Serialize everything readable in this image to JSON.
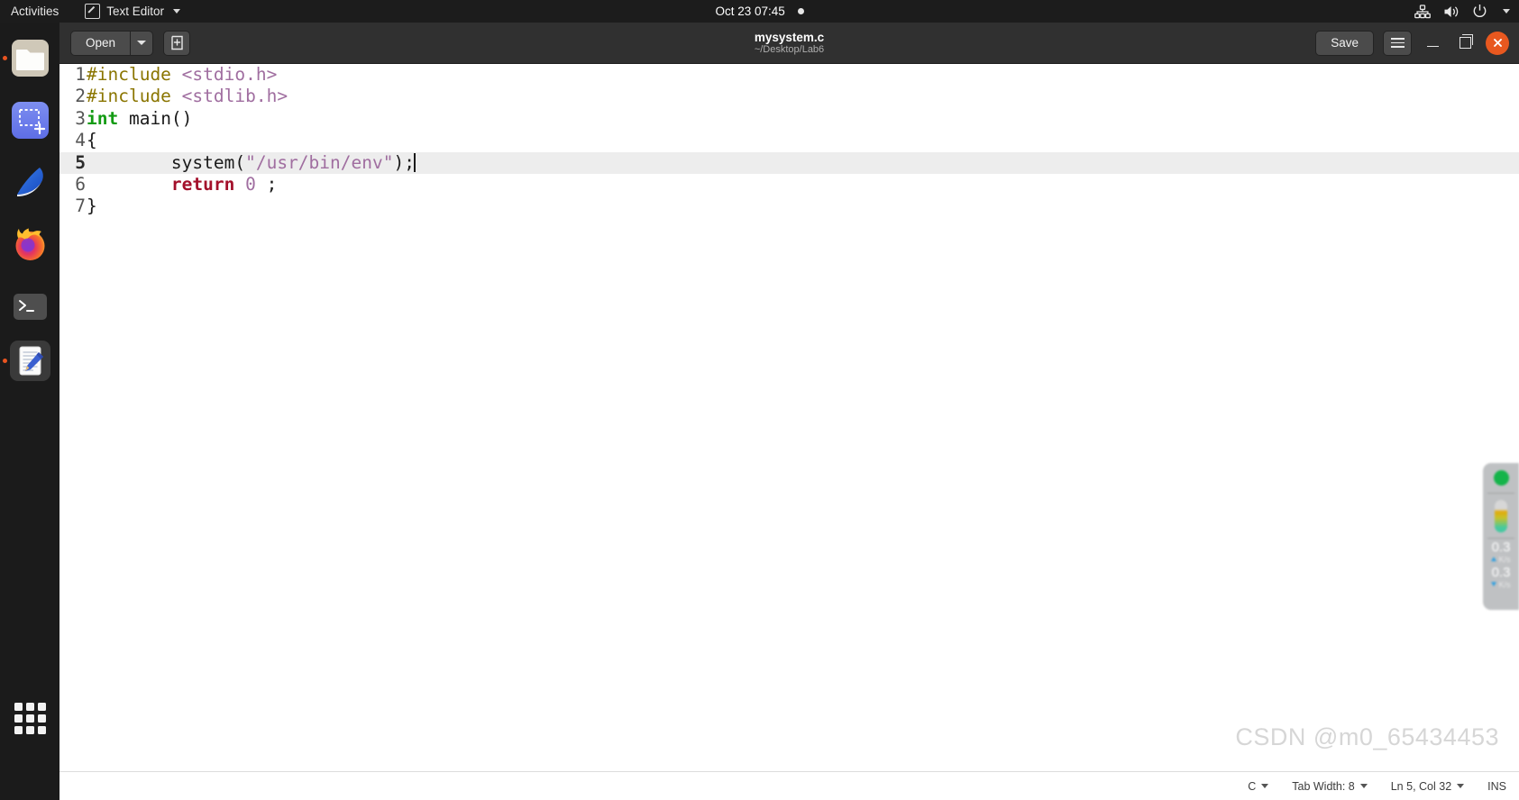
{
  "topbar": {
    "activities": "Activities",
    "app_name": "Text Editor",
    "app_icon": "text-editor-icon",
    "clock": "Oct 23  07:45",
    "notification_dot": "notification-indicator",
    "icons": [
      "network-icon",
      "volume-icon",
      "power-icon",
      "chevron-down-icon"
    ]
  },
  "dock": {
    "items": [
      {
        "name": "files",
        "label": "Files",
        "running": true,
        "active": false
      },
      {
        "name": "screenshot",
        "label": "Screenshot",
        "running": false,
        "active": false
      },
      {
        "name": "wireshark",
        "label": "Wireshark",
        "running": false,
        "active": false
      },
      {
        "name": "firefox",
        "label": "Firefox",
        "running": false,
        "active": false
      },
      {
        "name": "terminal",
        "label": "Terminal",
        "running": false,
        "active": false
      },
      {
        "name": "text-editor",
        "label": "Text Editor",
        "running": true,
        "active": true
      }
    ],
    "show_apps_label": "Show Applications"
  },
  "window": {
    "header": {
      "open_label": "Open",
      "open_dropdown": "open-dropdown-arrow",
      "new_document": "new-document-icon",
      "title": "mysystem.c",
      "subtitle": "~/Desktop/Lab6",
      "save_label": "Save",
      "menu": "hamburger-menu-icon",
      "minimize": "minimize-icon",
      "maximize": "restore-icon",
      "close": "close-icon",
      "close_color": "#e8581f"
    },
    "editor": {
      "current_line": 5,
      "lines": [
        {
          "num": "1",
          "tokens": [
            {
              "t": "#include ",
              "c": "tk-pre"
            },
            {
              "t": "<stdio.h>",
              "c": "tk-inc"
            }
          ]
        },
        {
          "num": "2",
          "tokens": [
            {
              "t": "#include ",
              "c": "tk-pre"
            },
            {
              "t": "<stdlib.h>",
              "c": "tk-inc"
            }
          ]
        },
        {
          "num": "3",
          "tokens": [
            {
              "t": "int",
              "c": "tk-type"
            },
            {
              "t": " main()",
              "c": "tk-plain"
            }
          ]
        },
        {
          "num": "4",
          "tokens": [
            {
              "t": "{",
              "c": "tk-plain"
            }
          ]
        },
        {
          "num": "5",
          "tokens": [
            {
              "t": "        system(",
              "c": "tk-plain"
            },
            {
              "t": "\"/usr/bin/env\"",
              "c": "tk-str"
            },
            {
              "t": ");",
              "c": "tk-plain"
            }
          ]
        },
        {
          "num": "6",
          "tokens": [
            {
              "t": "        ",
              "c": "tk-plain"
            },
            {
              "t": "return",
              "c": "tk-kw"
            },
            {
              "t": " ",
              "c": "tk-plain"
            },
            {
              "t": "0",
              "c": "tk-num"
            },
            {
              "t": " ;",
              "c": "tk-plain"
            }
          ]
        },
        {
          "num": "7",
          "tokens": [
            {
              "t": "}",
              "c": "tk-plain"
            }
          ]
        }
      ]
    },
    "statusbar": {
      "language": "C",
      "tab_width": "Tab Width: 8",
      "position": "Ln 5, Col 32",
      "insert_mode": "INS"
    }
  },
  "watermark": "CSDN @m0_65434453",
  "netmonitor": {
    "status_dot_color": "#14b44a",
    "upload_value": "0.3",
    "upload_unit": "K/s",
    "download_value": "0.3",
    "download_unit": "K/s"
  }
}
